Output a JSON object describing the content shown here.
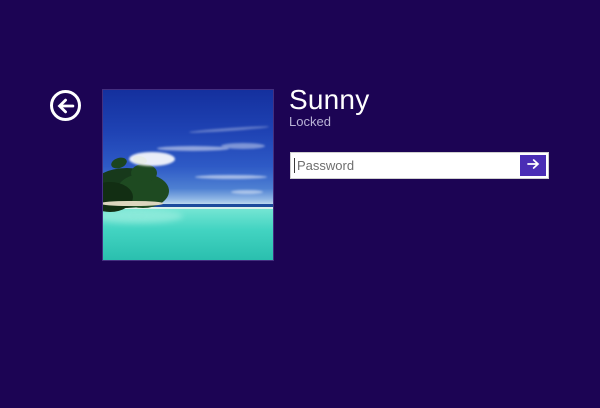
{
  "user": {
    "name": "Sunny",
    "status": "Locked"
  },
  "password_field": {
    "placeholder": "Password",
    "value": ""
  },
  "icons": {
    "back": "back-arrow-icon",
    "submit": "submit-arrow-icon",
    "avatar": "tropical-island-photo"
  },
  "colors": {
    "background": "#1c0454",
    "submit_button": "#4a2db5",
    "name_text": "#ffffff",
    "status_text": "#b9b3d6",
    "placeholder_text": "#6e6e6e",
    "field_background": "#ffffff"
  }
}
